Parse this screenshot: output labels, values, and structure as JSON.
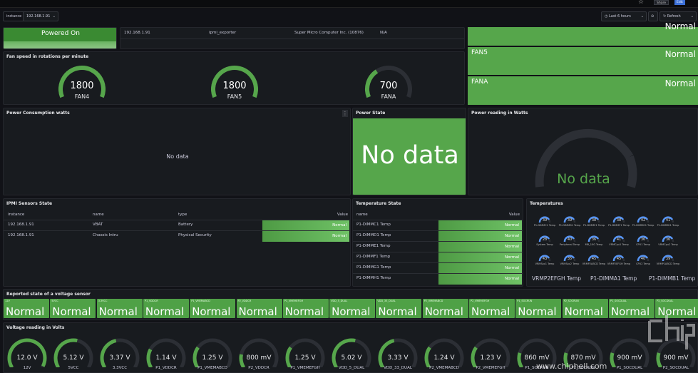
{
  "topbar": {
    "share": "Share",
    "edit": "Edit"
  },
  "vars": {
    "instance_label": "instance",
    "instance_value": "192.168.1.91"
  },
  "time": {
    "range": "Last 6 hours",
    "refresh": "Refresh"
  },
  "power_on": {
    "text": "Powered On"
  },
  "info_row": {
    "ip": "192.168.1.91",
    "job": "ipmi_exporter",
    "manufacturer": "Super Micro Computer Inc. (10876)",
    "na": "N/A"
  },
  "fan_status": {
    "top": "Normal",
    "rows": [
      {
        "name": "FAN5",
        "state": "Normal"
      },
      {
        "name": "FANA",
        "state": "Normal"
      }
    ]
  },
  "fan_speed": {
    "title": "Fan speed in rotations per minute",
    "gauges": [
      {
        "name": "FAN4",
        "value": "1800",
        "fraction": 1.0
      },
      {
        "name": "FAN5",
        "value": "1800",
        "fraction": 1.0
      },
      {
        "name": "FANA",
        "value": "700",
        "fraction": 0.35
      }
    ]
  },
  "power_consumption": {
    "title": "Power Consumption watts",
    "empty": "No data"
  },
  "power_state": {
    "title": "Power State",
    "empty": "No data"
  },
  "power_reading": {
    "title": "Power reading in Watts",
    "empty": "No data"
  },
  "ipmi_sensors": {
    "title": "IPMI Sensors State",
    "headers": [
      "instance",
      "name",
      "type",
      "Value"
    ],
    "rows": [
      [
        "192.168.1.91",
        "VBAT",
        "Battery",
        "Normal"
      ],
      [
        "192.168.1.91",
        "Chassis Intru",
        "Physical Security",
        "Normal"
      ]
    ]
  },
  "temp_state": {
    "title": "Temperature State",
    "headers": [
      "name",
      "Value"
    ],
    "rows": [
      [
        "P1-DIMMC1 Temp",
        "Normal"
      ],
      [
        "P1-DIMMD1 Temp",
        "Normal"
      ],
      [
        "P1-DIMME1 Temp",
        "Normal"
      ],
      [
        "P1-DIMMF1 Temp",
        "Normal"
      ],
      [
        "P1-DIMMG1 Temp",
        "Normal"
      ],
      [
        "P1-DIMMH1 Temp",
        "Normal"
      ]
    ]
  },
  "temperatures": {
    "title": "Temperatures",
    "gauges": [
      {
        "v": "39",
        "n": "P1-DIMMC1 Temp"
      },
      {
        "v": "39",
        "n": "P1-DIMMD1 Temp"
      },
      {
        "v": "38",
        "n": "P1-DIMME1 Temp"
      },
      {
        "v": "38",
        "n": "P1-DIMMF1 Temp"
      },
      {
        "v": "42",
        "n": "P1-DIMMG1 Temp"
      },
      {
        "v": "41",
        "n": "P1-DIMMH1 Temp"
      },
      {
        "v": "28",
        "n": "System Temp"
      },
      {
        "v": "40",
        "n": "Peripheral Temp"
      },
      {
        "v": "36",
        "n": "MB_10G Temp"
      },
      {
        "v": "41",
        "n": "VRMCpu1 Temp"
      },
      {
        "v": "36",
        "n": "CPU1 Temp"
      },
      {
        "v": "36",
        "n": "VRMCpu2 Temp"
      },
      {
        "v": "43",
        "n": "VRMSoc1 Temp"
      },
      {
        "v": "35",
        "n": "VRMSoc2 Temp"
      },
      {
        "v": "45",
        "n": "VRMP2ABCD Temp"
      },
      {
        "v": "45",
        "n": "VRMP2EFGH Temp"
      },
      {
        "v": "40",
        "n": "CPU2 Temp"
      },
      {
        "v": "39",
        "n": "VRMP1ABCD Temp"
      }
    ],
    "large_labels": [
      "VRMP2EFGH Temp",
      "P1-DIMMA1 Temp",
      "P1-DIMMB1 Temp"
    ]
  },
  "voltage_state": {
    "title": "Reported state of a voltage sensor",
    "items": [
      {
        "l": "12V",
        "v": "Normal"
      },
      {
        "l": "5VCC",
        "v": "Normal"
      },
      {
        "l": "3.3VCC",
        "v": "Normal"
      },
      {
        "l": "P1_VDDCR",
        "v": "Normal"
      },
      {
        "l": "P1_VMEMABCD",
        "v": "Normal"
      },
      {
        "l": "P2_VDDCR",
        "v": "Normal"
      },
      {
        "l": "P1_VMEMEFGH",
        "v": "Normal"
      },
      {
        "l": "VDD_5_DUAL",
        "v": "Normal"
      },
      {
        "l": "VDD_33_DUAL",
        "v": "Normal"
      },
      {
        "l": "P2_VMEMABCD",
        "v": "Normal"
      },
      {
        "l": "P2_VMEMEFGH",
        "v": "Normal"
      },
      {
        "l": "P1_SOCRUN",
        "v": "Normal"
      },
      {
        "l": "P2_SOCRUN",
        "v": "Normal"
      },
      {
        "l": "P1_SOCDUAL",
        "v": "Normal"
      },
      {
        "l": "P2_SOCDUAL",
        "v": "Normal"
      }
    ]
  },
  "voltage_reading": {
    "title": "Voltage reading in Volts",
    "gauges": [
      {
        "v": "12.0 V",
        "n": "12V",
        "f": 0.98
      },
      {
        "v": "5.12 V",
        "n": "5VCC",
        "f": 0.55
      },
      {
        "v": "3.37 V",
        "n": "3.3VCC",
        "f": 0.45
      },
      {
        "v": "1.14 V",
        "n": "P1_VDDCR",
        "f": 0.25
      },
      {
        "v": "1.25 V",
        "n": "P1_VMEMABCD",
        "f": 0.28
      },
      {
        "v": "800 mV",
        "n": "P2_VDDCR",
        "f": 0.18
      },
      {
        "v": "1.25 V",
        "n": "P1_VMEMEFGH",
        "f": 0.28
      },
      {
        "v": "5.02 V",
        "n": "VDD_5_DUAL",
        "f": 0.55
      },
      {
        "v": "3.33 V",
        "n": "VDD_33_DUAL",
        "f": 0.45
      },
      {
        "v": "1.24 V",
        "n": "P2_VMEMABCD",
        "f": 0.28
      },
      {
        "v": "1.23 V",
        "n": "P2_VMEMEFGH",
        "f": 0.28
      },
      {
        "v": "860 mV",
        "n": "P1_SOCRUN",
        "f": 0.2
      },
      {
        "v": "870 mV",
        "n": "P2_SOCRUN",
        "f": 0.2
      },
      {
        "v": "900 mV",
        "n": "P1_SOCDUAL",
        "f": 0.2
      },
      {
        "v": "900 mV",
        "n": "P2_SOCDUAL",
        "f": 0.2
      }
    ]
  },
  "watermark": {
    "site": "www.chiphell.com"
  },
  "colors": {
    "green": "#56a64b",
    "panel": "#181b1f",
    "bg": "#111217",
    "gauge_track": "#2c2f35"
  }
}
